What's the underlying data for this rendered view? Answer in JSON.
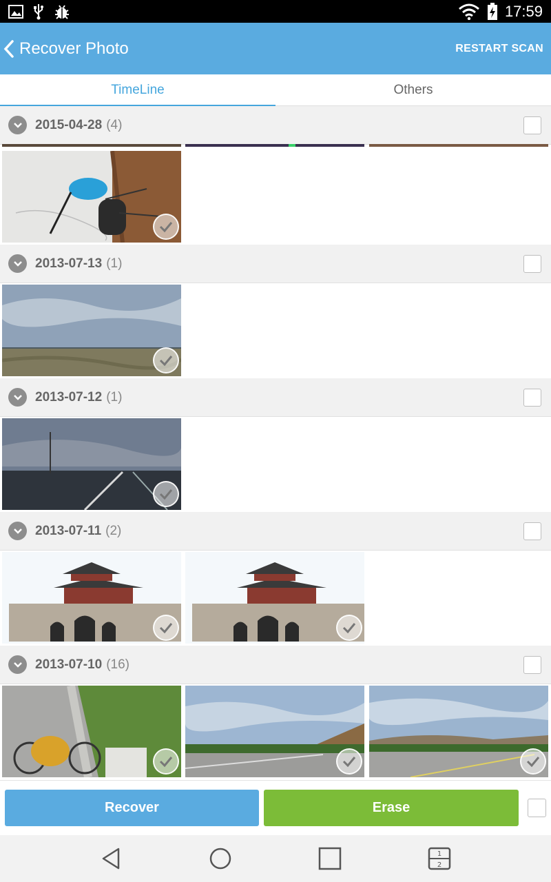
{
  "status_bar": {
    "time": "17:59",
    "left_icons": [
      "image-icon",
      "usb-icon",
      "bug-icon"
    ],
    "right_icons": [
      "wifi-icon",
      "battery-charging-icon"
    ]
  },
  "app_bar": {
    "title": "Recover Photo",
    "action": "RESTART SCAN",
    "color": "#5aabe0"
  },
  "tabs": [
    {
      "label": "TimeLine",
      "active": true
    },
    {
      "label": "Others",
      "active": false
    }
  ],
  "groups": [
    {
      "date": "2015-04-28",
      "count": "(4)"
    },
    {
      "date": "2013-07-13",
      "count": "(1)"
    },
    {
      "date": "2013-07-12",
      "count": "(1)"
    },
    {
      "date": "2013-07-11",
      "count": "(2)"
    },
    {
      "date": "2013-07-10",
      "count": "(16)"
    }
  ],
  "actions": {
    "recover_label": "Recover",
    "erase_label": "Erase",
    "recover_color": "#5aabe0",
    "erase_color": "#7cbc38"
  },
  "nav": [
    "back-icon",
    "home-icon",
    "recents-icon",
    "split-screen-icon"
  ]
}
